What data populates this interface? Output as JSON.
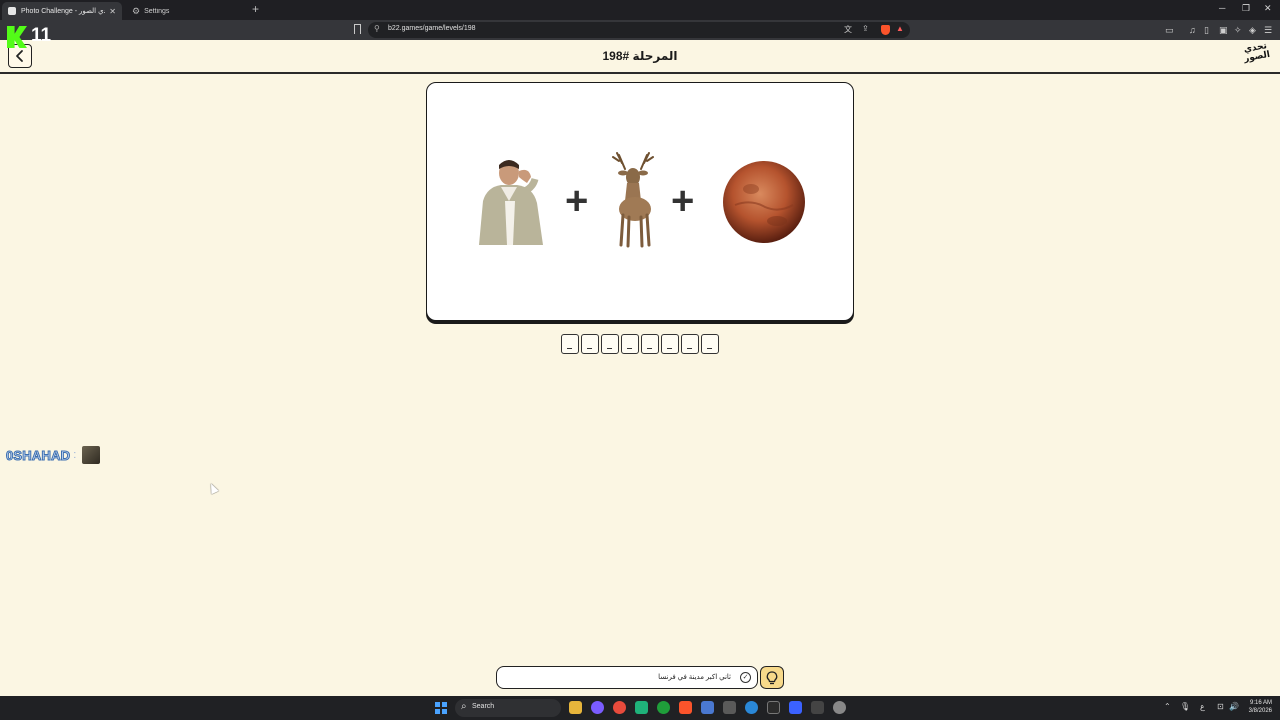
{
  "browser": {
    "tabs": [
      {
        "title": "Photo Challenge - لعبة تحدي الصور",
        "active": true
      },
      {
        "title": "Settings",
        "active": false
      }
    ],
    "url": "b22.games/game/levels/198"
  },
  "stream_badge": {
    "count": "11",
    "color": "#53fc18"
  },
  "page": {
    "level_title": "المرحلة #198",
    "logo_text": "تحدي الصور",
    "puzzle": {
      "pictures": [
        "shouting-man",
        "deer",
        "mars-planet"
      ],
      "operator": "+"
    },
    "answer_letter_count": 8,
    "hint_text": "ثاني اكبر مدينة في فرنسا"
  },
  "viewer": {
    "name": "0SHAHAD",
    "separator": ":"
  },
  "taskbar": {
    "search_placeholder": "Search",
    "time": "9:16 AM",
    "date": "3/8/2026",
    "language": "ع"
  },
  "colors": {
    "background": "#fbf6e3",
    "card": "#ffffff",
    "hint_button": "#f7d98a",
    "stream": "#53fc18"
  }
}
